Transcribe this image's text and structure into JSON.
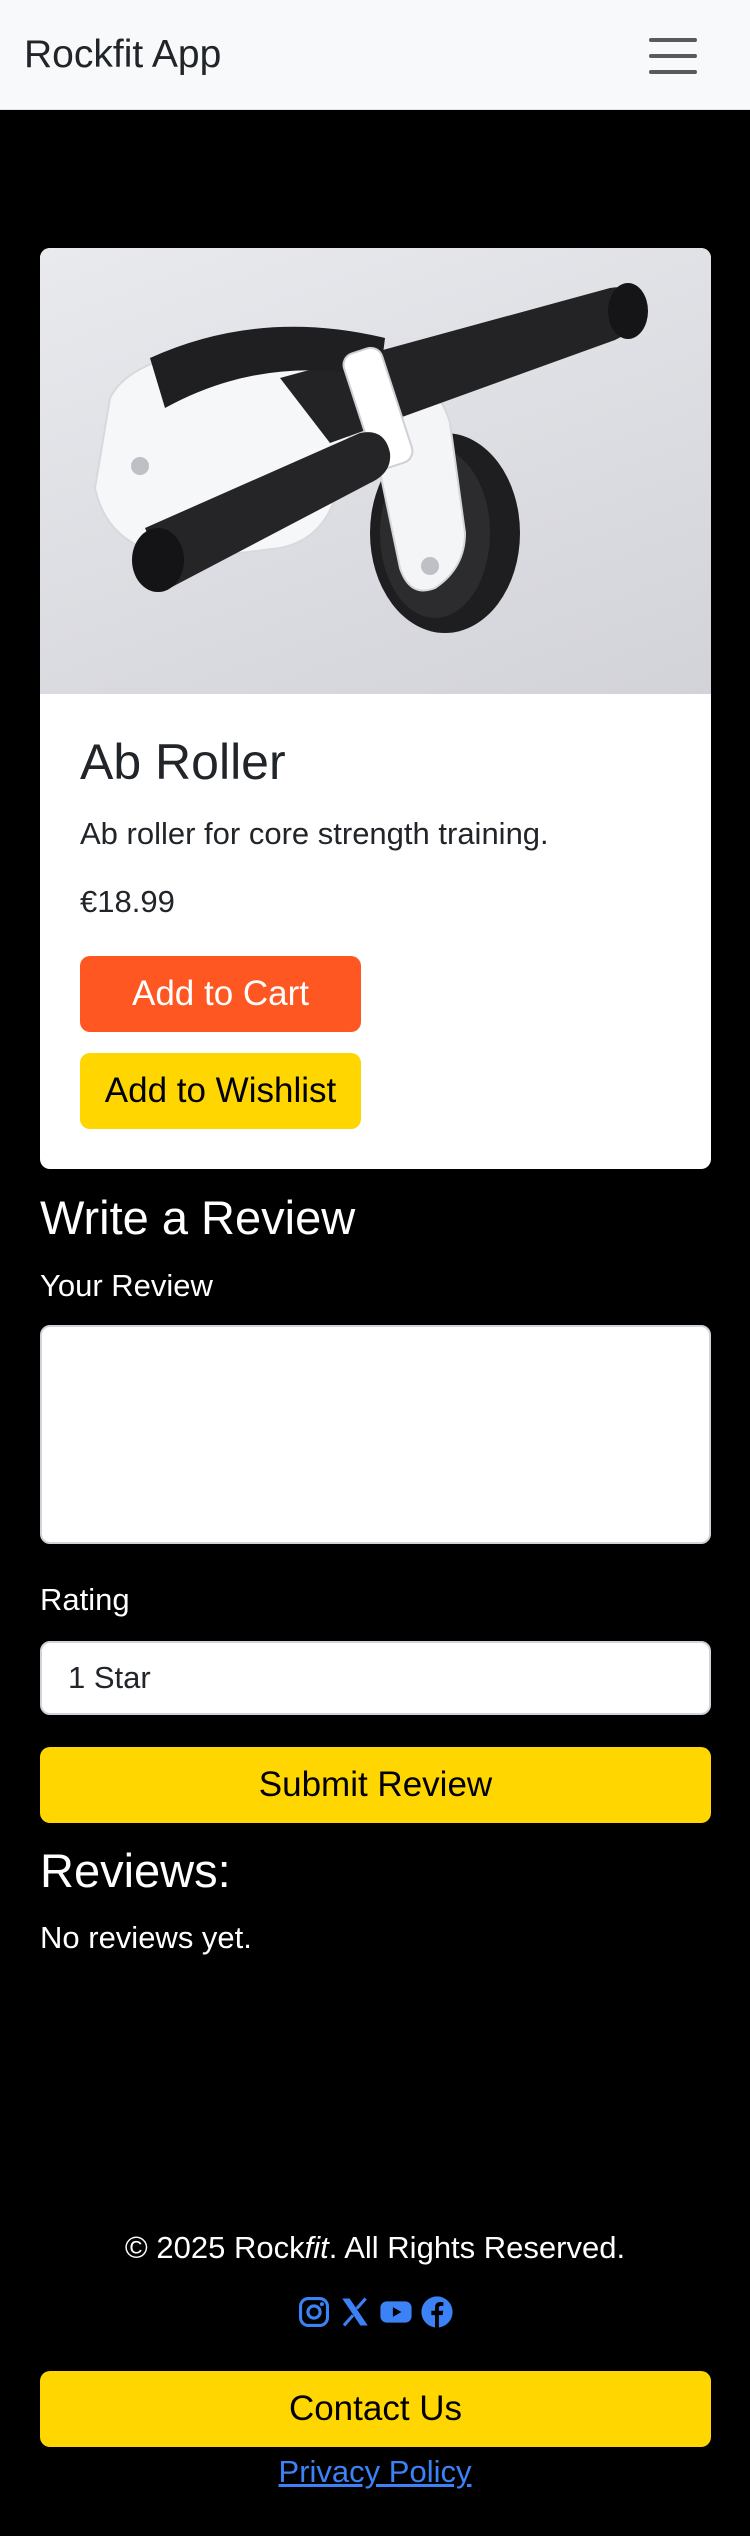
{
  "navbar": {
    "brand": "Rockfit App",
    "menu_icon": "hamburger-menu-icon"
  },
  "product": {
    "image_icon": "ab-roller-photo",
    "title": "Ab Roller",
    "description": "Ab roller for core strength training.",
    "price": "€18.99",
    "add_to_cart_label": "Add to Cart",
    "add_to_wishlist_label": "Add to Wishlist"
  },
  "review_form": {
    "heading": "Write a Review",
    "review_label": "Your Review",
    "review_value": "",
    "rating_label": "Rating",
    "rating_selected": "1 Star",
    "submit_label": "Submit Review"
  },
  "reviews": {
    "heading": "Reviews:",
    "empty_text": "No reviews yet."
  },
  "footer": {
    "copyright_prefix": "© 2025 Rock",
    "copyright_brand_italic": "fit",
    "copyright_suffix": ". All Rights Reserved.",
    "social_icons": [
      "instagram-icon",
      "x-icon",
      "youtube-icon",
      "facebook-icon"
    ],
    "contact_label": "Contact Us",
    "privacy_label": "Privacy Policy"
  },
  "colors": {
    "background": "#000000",
    "navbar": "#f8f9fa",
    "cart_button": "#ff5722",
    "accent_yellow": "#ffd600",
    "link_blue": "#3b82f6"
  }
}
